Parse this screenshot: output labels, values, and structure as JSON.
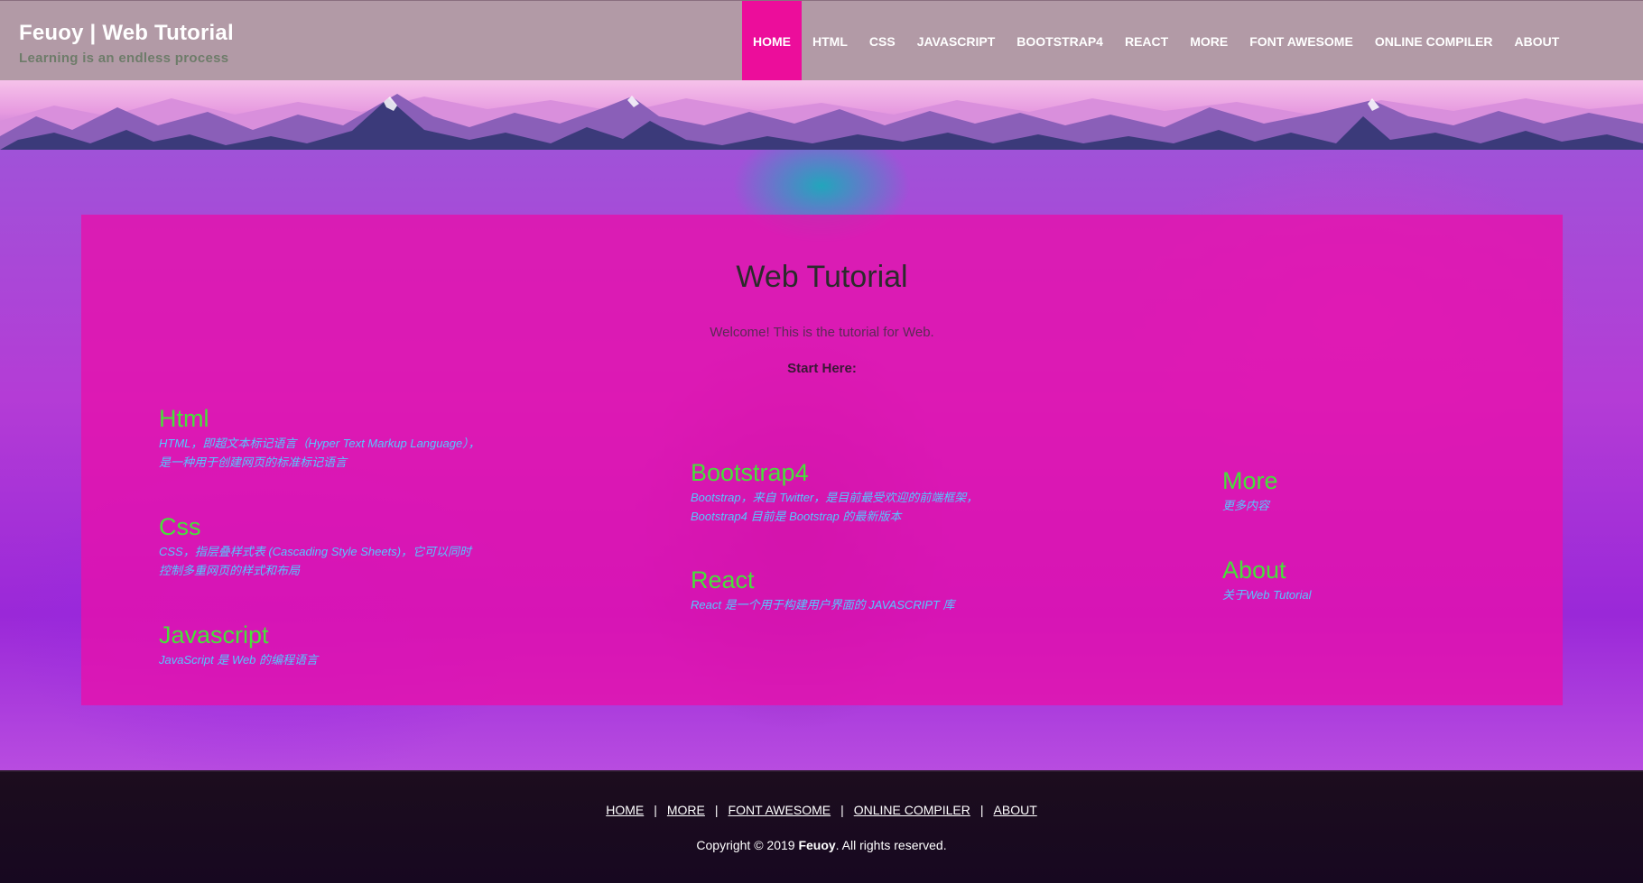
{
  "header": {
    "title": "Feuoy | Web Tutorial",
    "subtitle": "Learning is an endless process",
    "nav": [
      {
        "label": "HOME",
        "active": true
      },
      {
        "label": "HTML"
      },
      {
        "label": "CSS"
      },
      {
        "label": "JAVASCRIPT"
      },
      {
        "label": "BOOTSTRAP4"
      },
      {
        "label": "REACT"
      },
      {
        "label": "MORE"
      },
      {
        "label": "FONT AWESOME"
      },
      {
        "label": "ONLINE COMPILER"
      },
      {
        "label": "ABOUT"
      }
    ]
  },
  "main": {
    "title": "Web Tutorial",
    "welcome": "Welcome! This is the tutorial for Web.",
    "start": "Start Here:",
    "topics": [
      {
        "title": "Html",
        "desc": [
          "HTML，即超文本标记语言（Hyper Text Markup Language），",
          "是一种用于创建网页的标准标记语言"
        ]
      },
      {
        "title": "Css",
        "desc": [
          "CSS，指层叠样式表 (Cascading Style Sheets)，它可以同时",
          "控制多重网页的样式和布局"
        ]
      },
      {
        "title": "Javascript",
        "desc": [
          "JavaScript 是 Web 的编程语言"
        ]
      },
      {
        "title": "Bootstrap4",
        "desc": [
          "Bootstrap，来自 Twitter，是目前最受欢迎的前端框架，",
          "Bootstrap4 目前是 Bootstrap 的最新版本"
        ]
      },
      {
        "title": "React",
        "desc": [
          "React 是一个用于构建用户界面的 JAVASCRIPT 库"
        ]
      },
      {
        "title": "More",
        "desc": [
          "更多内容"
        ]
      },
      {
        "title": "About",
        "desc": [
          "关于Web Tutorial"
        ]
      }
    ]
  },
  "footer": {
    "links": [
      "HOME",
      "MORE",
      "FONT AWESOME",
      "ONLINE COMPILER",
      "ABOUT"
    ],
    "separator": "|",
    "copyright_prefix": "Copyright © 2019 ",
    "copyright_brand": "Feuoy",
    "copyright_suffix": ". All rights reserved."
  },
  "colors": {
    "header_bg": "#b29aa6",
    "nav_active": "#ec0d9b",
    "topic_title": "#48e03a",
    "topic_desc": "#55c8ff",
    "card_bg": "#e810aa",
    "footer_bg": "#1c0d1e"
  }
}
